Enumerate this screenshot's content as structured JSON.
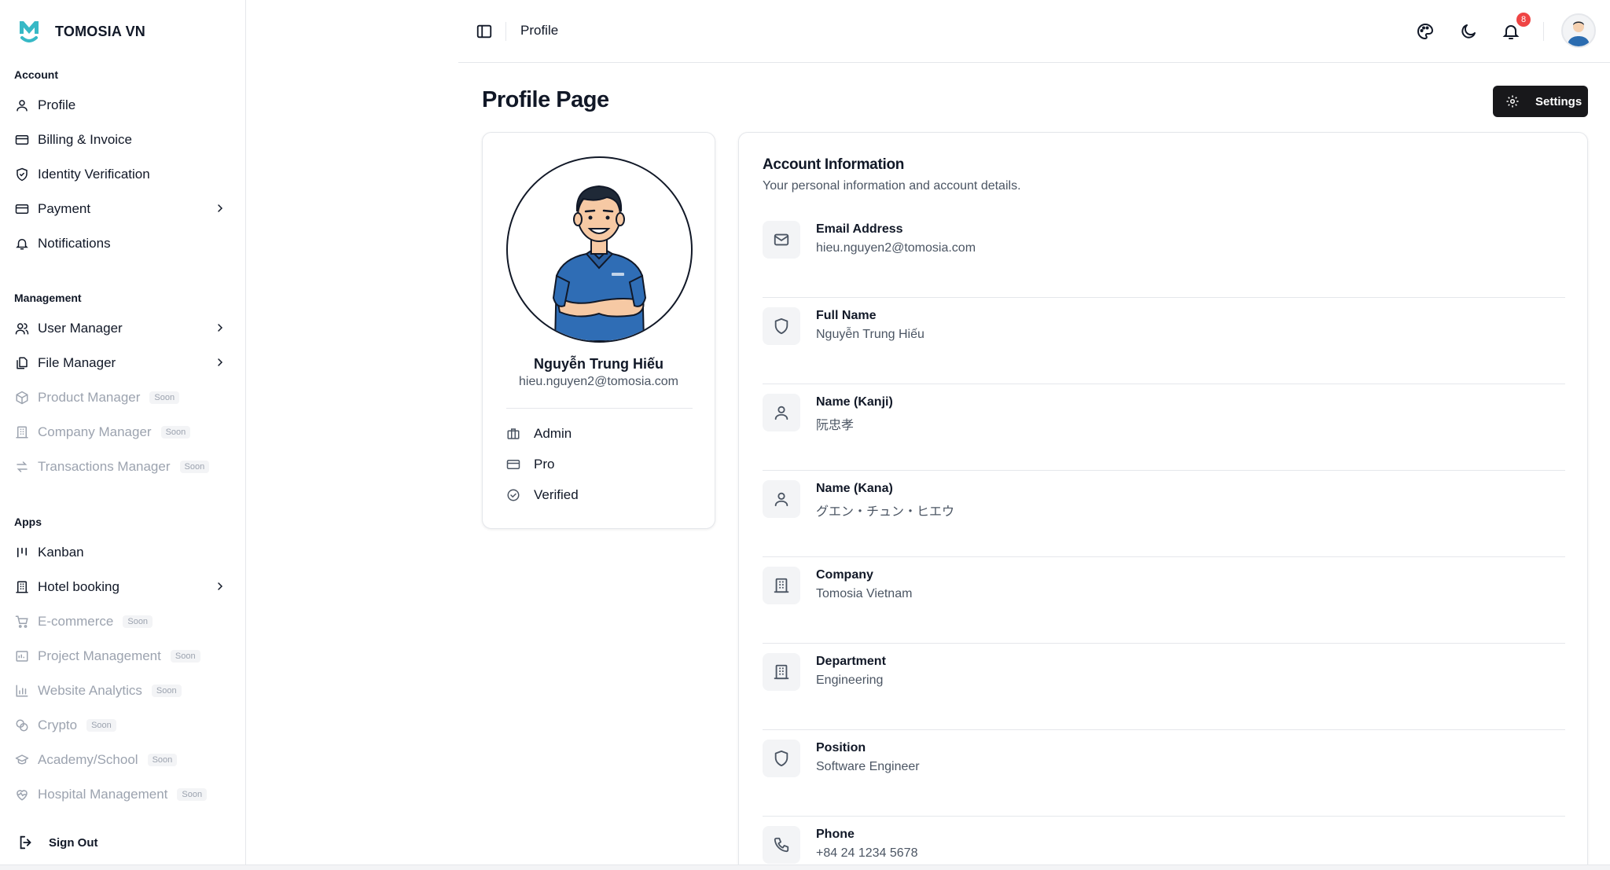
{
  "brand": {
    "name": "TOMOSIA VN",
    "logo_icon": "tomosia-m-logo",
    "accent": "#37b9c6"
  },
  "sidebar": {
    "sections": [
      {
        "title": "Account",
        "items": [
          {
            "label": "Profile",
            "icon": "user-icon",
            "chevron": false,
            "soon": ""
          },
          {
            "label": "Billing & Invoice",
            "icon": "credit-card-icon",
            "chevron": false,
            "soon": ""
          },
          {
            "label": "Identity Verification",
            "icon": "shield-check-icon",
            "chevron": false,
            "soon": ""
          },
          {
            "label": "Payment",
            "icon": "credit-card-icon",
            "chevron": true,
            "soon": ""
          },
          {
            "label": "Notifications",
            "icon": "bell-icon",
            "chevron": false,
            "soon": ""
          }
        ]
      },
      {
        "title": "Management",
        "items": [
          {
            "label": "User Manager",
            "icon": "users-icon",
            "chevron": true,
            "soon": ""
          },
          {
            "label": "File Manager",
            "icon": "files-icon",
            "chevron": true,
            "soon": ""
          },
          {
            "label": "Product Manager",
            "icon": "package-icon",
            "chevron": false,
            "soon": "Soon"
          },
          {
            "label": "Company Manager",
            "icon": "building-icon",
            "chevron": false,
            "soon": "Soon"
          },
          {
            "label": "Transactions Manager",
            "icon": "arrows-swap-icon",
            "chevron": false,
            "soon": "Soon"
          }
        ]
      },
      {
        "title": "Apps",
        "items": [
          {
            "label": "Kanban",
            "icon": "kanban-icon",
            "chevron": false,
            "soon": ""
          },
          {
            "label": "Hotel booking",
            "icon": "building-icon",
            "chevron": true,
            "soon": ""
          },
          {
            "label": "E-commerce",
            "icon": "cart-icon",
            "chevron": false,
            "soon": "Soon"
          },
          {
            "label": "Project Management",
            "icon": "folder-icon",
            "chevron": false,
            "soon": "Soon"
          },
          {
            "label": "Website Analytics",
            "icon": "bar-chart-icon",
            "chevron": false,
            "soon": "Soon"
          },
          {
            "label": "Crypto",
            "icon": "coins-icon",
            "chevron": false,
            "soon": "Soon"
          },
          {
            "label": "Academy/School",
            "icon": "graduation-cap-icon",
            "chevron": false,
            "soon": "Soon"
          },
          {
            "label": "Hospital Management",
            "icon": "heart-pulse-icon",
            "chevron": false,
            "soon": "Soon"
          }
        ]
      }
    ],
    "sign_out": "Sign Out"
  },
  "topbar": {
    "breadcrumb": "Profile",
    "notification_count": "8",
    "badge_color": "#ef4444"
  },
  "page": {
    "title": "Profile Page",
    "settings_label": "Settings"
  },
  "profile_card": {
    "name": "Nguyễn Trung Hiếu",
    "email": "hieu.nguyen2@tomosia.com",
    "attributes": [
      {
        "label": "Admin",
        "icon": "briefcase-icon"
      },
      {
        "label": "Pro",
        "icon": "credit-card-icon"
      },
      {
        "label": "Verified",
        "icon": "check-circle-icon"
      }
    ]
  },
  "account_info": {
    "title": "Account Information",
    "subtitle": "Your personal information and account details.",
    "rows": [
      {
        "label": "Email Address",
        "value": "hieu.nguyen2@tomosia.com",
        "icon": "mail-icon"
      },
      {
        "label": "Full Name",
        "value": "Nguyễn Trung Hiếu",
        "icon": "shield-icon"
      },
      {
        "label": "Name (Kanji)",
        "value": "阮忠孝",
        "icon": "user-icon"
      },
      {
        "label": "Name (Kana)",
        "value": "グエン・チュン・ヒエウ",
        "icon": "user-icon"
      },
      {
        "label": "Company",
        "value": "Tomosia Vietnam",
        "icon": "building-icon"
      },
      {
        "label": "Department",
        "value": "Engineering",
        "icon": "building-icon"
      },
      {
        "label": "Position",
        "value": "Software Engineer",
        "icon": "shield-icon"
      },
      {
        "label": "Phone",
        "value": "+84 24 1234 5678",
        "icon": "phone-icon"
      }
    ]
  }
}
